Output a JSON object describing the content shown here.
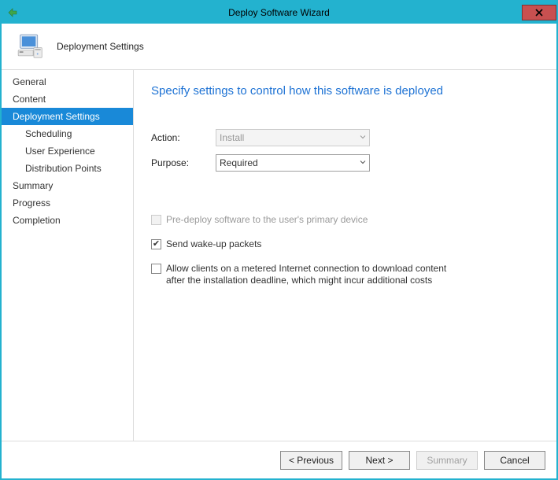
{
  "window": {
    "title": "Deploy Software Wizard"
  },
  "header": {
    "title": "Deployment Settings"
  },
  "sidebar": {
    "items": [
      {
        "label": "General",
        "sub": false,
        "selected": false
      },
      {
        "label": "Content",
        "sub": false,
        "selected": false
      },
      {
        "label": "Deployment Settings",
        "sub": false,
        "selected": true
      },
      {
        "label": "Scheduling",
        "sub": true,
        "selected": false
      },
      {
        "label": "User Experience",
        "sub": true,
        "selected": false
      },
      {
        "label": "Distribution Points",
        "sub": true,
        "selected": false
      },
      {
        "label": "Summary",
        "sub": false,
        "selected": false
      },
      {
        "label": "Progress",
        "sub": false,
        "selected": false
      },
      {
        "label": "Completion",
        "sub": false,
        "selected": false
      }
    ]
  },
  "content": {
    "title": "Specify settings to control how this software is deployed",
    "fields": {
      "action": {
        "label": "Action:",
        "value": "Install",
        "enabled": false
      },
      "purpose": {
        "label": "Purpose:",
        "value": "Required",
        "enabled": true
      }
    },
    "checkboxes": {
      "predeploy": {
        "label": "Pre-deploy software to the user's primary device",
        "checked": false,
        "enabled": false
      },
      "wakeup": {
        "label": "Send wake-up packets",
        "checked": true,
        "enabled": true
      },
      "metered": {
        "label": "Allow clients on a metered Internet connection to download content after the installation deadline, which might incur additional costs",
        "checked": false,
        "enabled": true
      }
    }
  },
  "footer": {
    "previous": "< Previous",
    "next": "Next >",
    "summary": "Summary",
    "cancel": "Cancel"
  }
}
